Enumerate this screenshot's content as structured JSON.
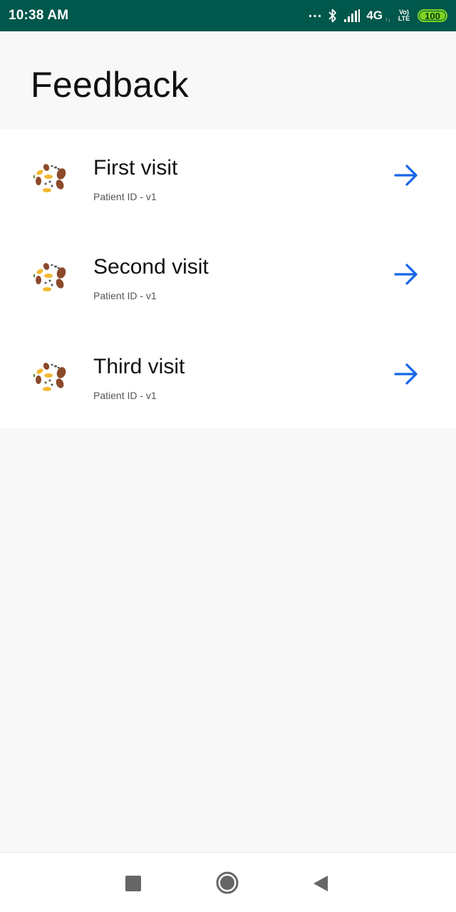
{
  "status_bar": {
    "time": "10:38 AM",
    "dots": "...",
    "network": "4G",
    "network_sub": "↑↓",
    "volte_top": "Vo)",
    "volte_bottom": "LTE",
    "battery": "100",
    "icons": [
      "bluetooth-icon",
      "signal-icon",
      "battery-icon"
    ],
    "colors": {
      "background": "#00574b",
      "battery": "#7ed321"
    }
  },
  "header": {
    "title": "Feedback"
  },
  "visits": [
    {
      "title": "First visit",
      "subtitle": "Patient ID - v1"
    },
    {
      "title": "Second visit",
      "subtitle": "Patient ID - v1"
    },
    {
      "title": "Third visit",
      "subtitle": "Patient ID - v1"
    }
  ],
  "accent_color": "#1565e8",
  "nav_bar": {
    "icons": [
      "recent-apps-icon",
      "home-icon",
      "back-icon"
    ]
  }
}
